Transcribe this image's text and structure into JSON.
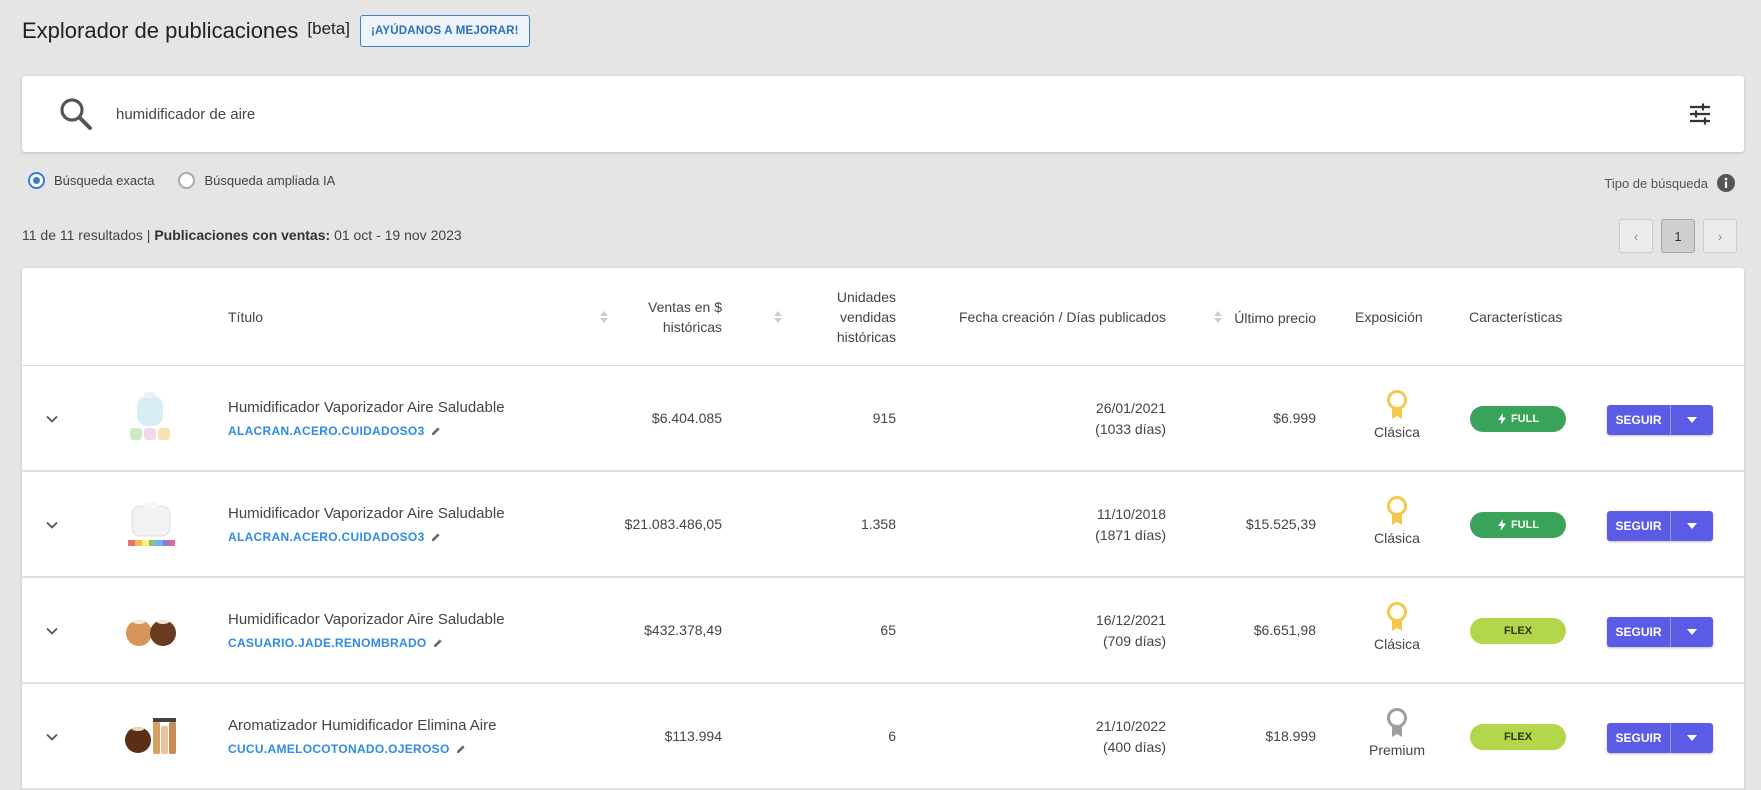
{
  "header": {
    "title": "Explorador de publicaciones",
    "beta": "[beta]",
    "help_button": "¡AYÚDANOS A MEJORAR!"
  },
  "search": {
    "value": "humidificador de aire",
    "icon": "search-icon",
    "filter_icon": "tune-icon"
  },
  "search_type": {
    "options": [
      {
        "label": "Búsqueda exacta",
        "selected": true
      },
      {
        "label": "Búsqueda ampliada IA",
        "selected": false
      }
    ],
    "tipo_label": "Tipo de búsqueda"
  },
  "results": {
    "count_text": "11 de 11 resultados |",
    "period_label": "Publicaciones con ventas:",
    "period_value": "01 oct - 19 nov 2023"
  },
  "pagination": {
    "prev": "‹",
    "current": "1",
    "next": "›"
  },
  "table": {
    "columns": {
      "title": "Título",
      "sales_line1": "Ventas en $",
      "sales_line2": "históricas",
      "units_line1": "Unidades",
      "units_line2": "vendidas",
      "units_line3": "históricas",
      "date": "Fecha creación / Días publicados",
      "price": "Último precio",
      "exposure": "Exposición",
      "features": "Características"
    },
    "follow_label": "SEGUIR",
    "rows": [
      {
        "title": "Humidificador Vaporizador Aire Saludable",
        "seller": "ALACRAN.ACERO.CUIDADOSO3",
        "sales": "$6.404.085",
        "units": "915",
        "date": "26/01/2021",
        "days": "(1033 días)",
        "price": "$6.999",
        "exposure": "Clásica",
        "medal": "gold",
        "badge": "FULL",
        "badge_type": "full"
      },
      {
        "title": "Humidificador Vaporizador Aire Saludable",
        "seller": "ALACRAN.ACERO.CUIDADOSO3",
        "sales": "$21.083.486,05",
        "units": "1.358",
        "date": "11/10/2018",
        "days": "(1871 días)",
        "price": "$15.525,39",
        "exposure": "Clásica",
        "medal": "gold",
        "badge": "FULL",
        "badge_type": "full"
      },
      {
        "title": "Humidificador Vaporizador Aire Saludable",
        "seller": "CASUARIO.JADE.RENOMBRADO",
        "sales": "$432.378,49",
        "units": "65",
        "date": "16/12/2021",
        "days": "(709 días)",
        "price": "$6.651,98",
        "exposure": "Clásica",
        "medal": "gold",
        "badge": "FLEX",
        "badge_type": "flex"
      },
      {
        "title": "Aromatizador Humidificador Elimina Aire",
        "seller": "CUCU.AMELOCOTONADO.OJEROSO",
        "sales": "$113.994",
        "units": "6",
        "date": "21/10/2022",
        "days": "(400 días)",
        "price": "$18.999",
        "exposure": "Premium",
        "medal": "silver",
        "badge": "FLEX",
        "badge_type": "flex"
      }
    ]
  },
  "colors": {
    "accent": "#5b5be6",
    "link": "#2f8be6",
    "full_badge": "#3aa35a",
    "flex_badge": "#b3d64a",
    "gold_medal": "#f2c94c",
    "silver_medal": "#9e9e9e"
  }
}
